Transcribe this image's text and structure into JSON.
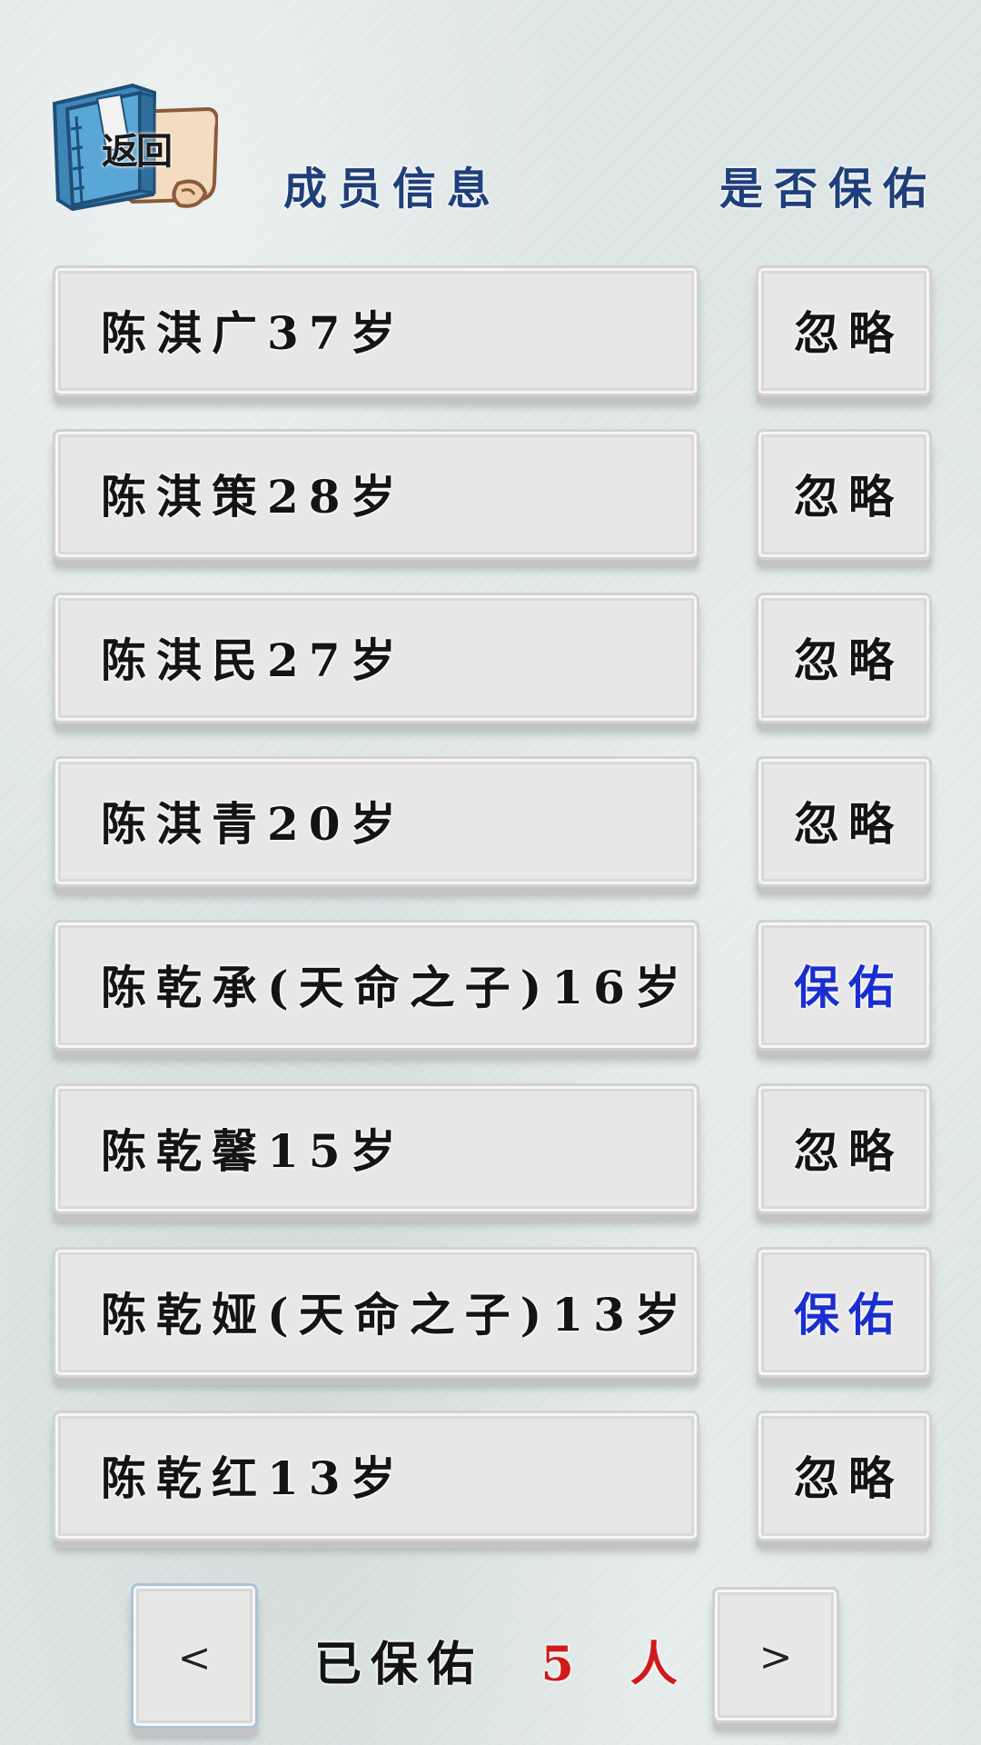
{
  "header": {
    "back_label": "返回",
    "members_title": "成员信息",
    "protect_title": "是否保佑"
  },
  "colors": {
    "ignore_text": "#141414",
    "protect_text": "#1a2fd0",
    "count_text": "#d11a1a",
    "header_text": "#1f3f7a"
  },
  "members": [
    {
      "name": "陈淇广37岁",
      "status": "忽略",
      "protected": false
    },
    {
      "name": "陈淇策28岁",
      "status": "忽略",
      "protected": false
    },
    {
      "name": "陈淇民27岁",
      "status": "忽略",
      "protected": false
    },
    {
      "name": "陈淇青20岁",
      "status": "忽略",
      "protected": false
    },
    {
      "name": "陈乾承(天命之子)16岁",
      "status": "保佑",
      "protected": true
    },
    {
      "name": "陈乾馨15岁",
      "status": "忽略",
      "protected": false
    },
    {
      "name": "陈乾娅(天命之子)13岁",
      "status": "保佑",
      "protected": true
    },
    {
      "name": "陈乾红13岁",
      "status": "忽略",
      "protected": false
    }
  ],
  "footer": {
    "prev_label": "<",
    "next_label": ">",
    "protected_label": "已保佑",
    "protected_count": "5 人"
  },
  "icons": {
    "back": "scroll-book-icon"
  }
}
